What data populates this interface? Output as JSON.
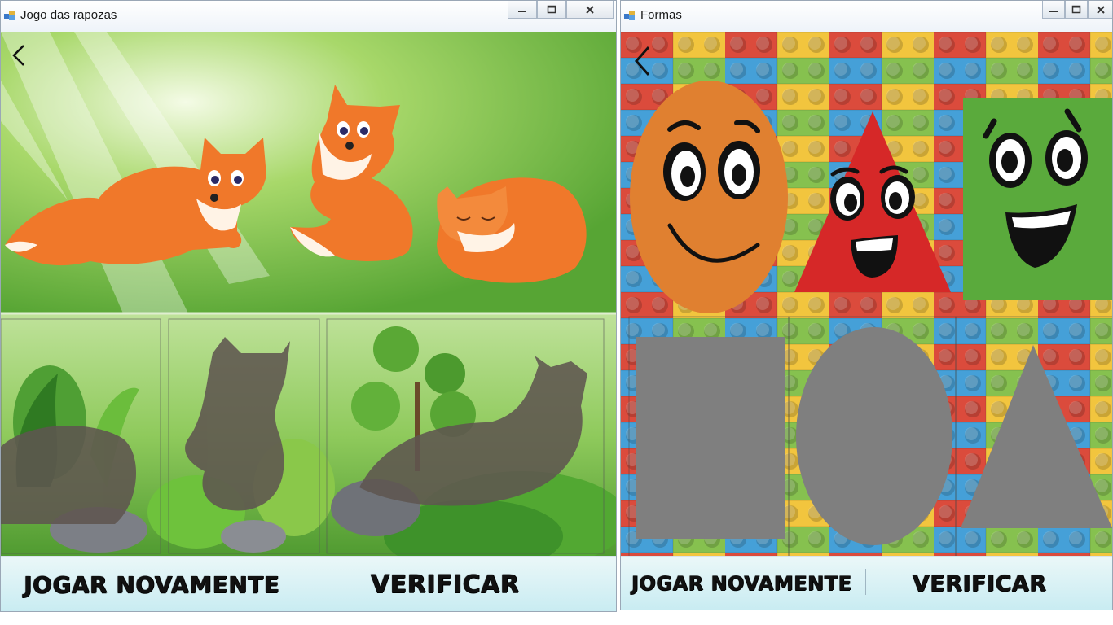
{
  "fox_window": {
    "title": "Jogo das rapozas",
    "buttons": {
      "play_again": "JOGAR NOVAMENTE",
      "verify": "VERIFICAR"
    },
    "colors": {
      "fox_orange": "#f0782a",
      "silhouette": "#5f5550",
      "sky_green": "#6dbb3a"
    }
  },
  "shapes_window": {
    "title": "Formas",
    "buttons": {
      "play_again": "JOGAR NOVAMENTE",
      "verify": "VERIFICAR"
    },
    "colors": {
      "circle": "#e08030",
      "triangle": "#d62828",
      "square": "#5aaa3c",
      "target": "#7f7f7f"
    }
  }
}
